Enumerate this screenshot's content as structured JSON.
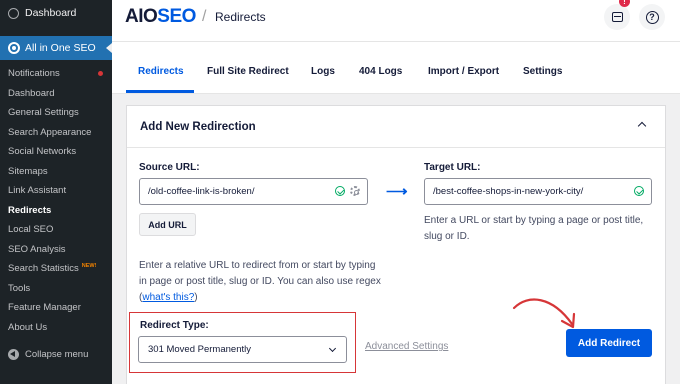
{
  "sidebar": {
    "dashboard": "Dashboard",
    "plugin": "All in One SEO",
    "items": [
      {
        "label": "Notifications"
      },
      {
        "label": "Dashboard"
      },
      {
        "label": "General Settings"
      },
      {
        "label": "Search Appearance"
      },
      {
        "label": "Social Networks"
      },
      {
        "label": "Sitemaps"
      },
      {
        "label": "Link Assistant"
      },
      {
        "label": "Redirects"
      },
      {
        "label": "Local SEO"
      },
      {
        "label": "SEO Analysis"
      },
      {
        "label": "Search Statistics",
        "badge": "NEW!"
      },
      {
        "label": "Tools"
      },
      {
        "label": "Feature Manager"
      },
      {
        "label": "About Us"
      }
    ],
    "collapse": "Collapse menu"
  },
  "header": {
    "logo_main": "AIO",
    "logo_accent": "SEO",
    "separator": "/",
    "breadcrumb": "Redirects",
    "notification_count": "!"
  },
  "tabs": [
    "Redirects",
    "Full Site Redirect",
    "Logs",
    "404 Logs",
    "Import / Export",
    "Settings"
  ],
  "card": {
    "title": "Add New Redirection",
    "source_label": "Source URL:",
    "source_value": "/old-coffee-link-is-broken/",
    "add_url": "Add URL",
    "source_help_pre": "Enter a relative URL to redirect from or start by typing in page or post title, slug or ID. You can also use regex (",
    "source_help_link": "what's this?",
    "source_help_post": ")",
    "target_label": "Target URL:",
    "target_value": "/best-coffee-shops-in-new-york-city/",
    "target_help": "Enter a URL or start by typing a page or post title, slug or ID.",
    "redirect_type_label": "Redirect Type:",
    "redirect_type_value": "301 Moved Permanently",
    "advanced": "Advanced Settings",
    "add_redirect": "Add Redirect"
  },
  "colors": {
    "accent": "#005ae0",
    "sidebar_bg": "#1d2327",
    "sidebar_active": "#2271b1",
    "highlight_red": "#d63638",
    "success": "#00aa63"
  }
}
